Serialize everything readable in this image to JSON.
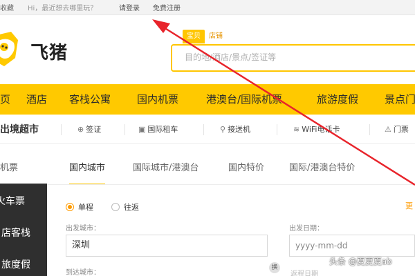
{
  "topbar": {
    "fav": "收藏",
    "greeting": "Hi，最近想去哪里玩？",
    "login": "请登录",
    "register": "免费注册"
  },
  "logo": {
    "text": "飞猪"
  },
  "search": {
    "tabs": [
      "宝贝",
      "店铺"
    ],
    "placeholder": "目的地/酒店/景点/签证等"
  },
  "mainnav": [
    "页",
    "酒店",
    "客栈公寓",
    "国内机票",
    "港澳台/国际机票",
    "旅游度假",
    "景点门"
  ],
  "subnav": [
    {
      "icon": "",
      "label": "出境超市"
    },
    {
      "icon": "passport-icon",
      "label": "签证"
    },
    {
      "icon": "car-icon",
      "label": "国际租车"
    },
    {
      "icon": "pickup-icon",
      "label": "接送机"
    },
    {
      "icon": "wifi-icon",
      "label": "WiFi电话卡"
    },
    {
      "icon": "ticket-icon",
      "label": "门票"
    }
  ],
  "flight_tabs": [
    "机票",
    "国内城市",
    "国际城市/港澳台",
    "国内特价",
    "国际/港澳台特价"
  ],
  "sidebar": [
    "火车票",
    "店客栈",
    "旅度假"
  ],
  "form": {
    "trip_types": [
      "单程",
      "往返"
    ],
    "depart_city_label": "出发城市：",
    "depart_city_value": "深圳",
    "depart_date_label": "出发日期：",
    "depart_date_placeholder": "yyyy-mm-dd",
    "arrive_city_label": "到达城市：",
    "return_date_placeholder": "返程日期",
    "swap_label": "换",
    "more_label": "更"
  },
  "watermark": "头条 @夏夏夏ab",
  "colors": {
    "brand": "#ffc900",
    "accent": "#ff9b00",
    "arrow": "#e8242b",
    "sidebar": "#2f2f2f"
  }
}
